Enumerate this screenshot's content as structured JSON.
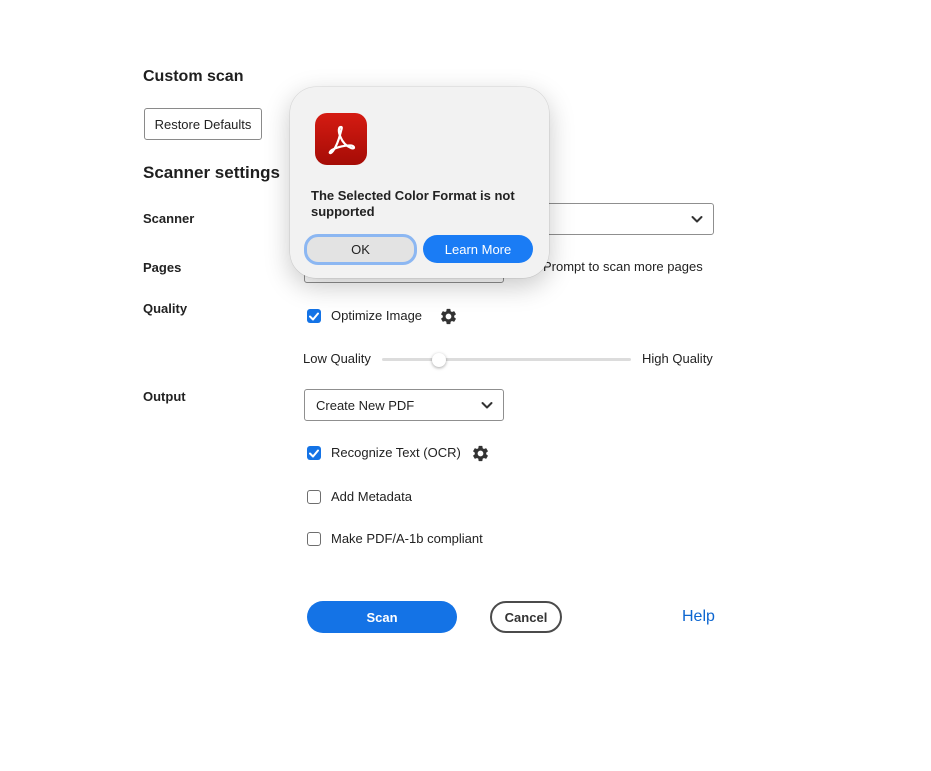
{
  "page": {
    "title": "Custom scan",
    "restore_defaults_label": "Restore Defaults",
    "section_title": "Scanner settings"
  },
  "labels": {
    "scanner": "Scanner",
    "pages": "Pages",
    "quality": "Quality",
    "output": "Output"
  },
  "scanner": {
    "selected_value": ""
  },
  "pages": {
    "prompt_label": "Prompt to scan more pages"
  },
  "quality": {
    "optimize_label": "Optimize Image",
    "optimize_checked": true,
    "low_label": "Low Quality",
    "high_label": "High Quality",
    "slider_fraction": 0.23
  },
  "output": {
    "selected_value": "Create New PDF",
    "ocr_label": "Recognize Text (OCR)",
    "ocr_checked": true,
    "metadata_label": "Add Metadata",
    "metadata_checked": false,
    "pdfa_label": "Make PDF/A-1b compliant",
    "pdfa_checked": false
  },
  "actions": {
    "scan_label": "Scan",
    "cancel_label": "Cancel",
    "help_label": "Help"
  },
  "dialog": {
    "message": "The Selected Color Format is not supported",
    "ok_label": "OK",
    "learn_more_label": "Learn More",
    "icon": "acrobat-icon"
  },
  "colors": {
    "accent": "#1473e6",
    "acrobat_red": "#c4140c",
    "link": "#0d66d0"
  }
}
